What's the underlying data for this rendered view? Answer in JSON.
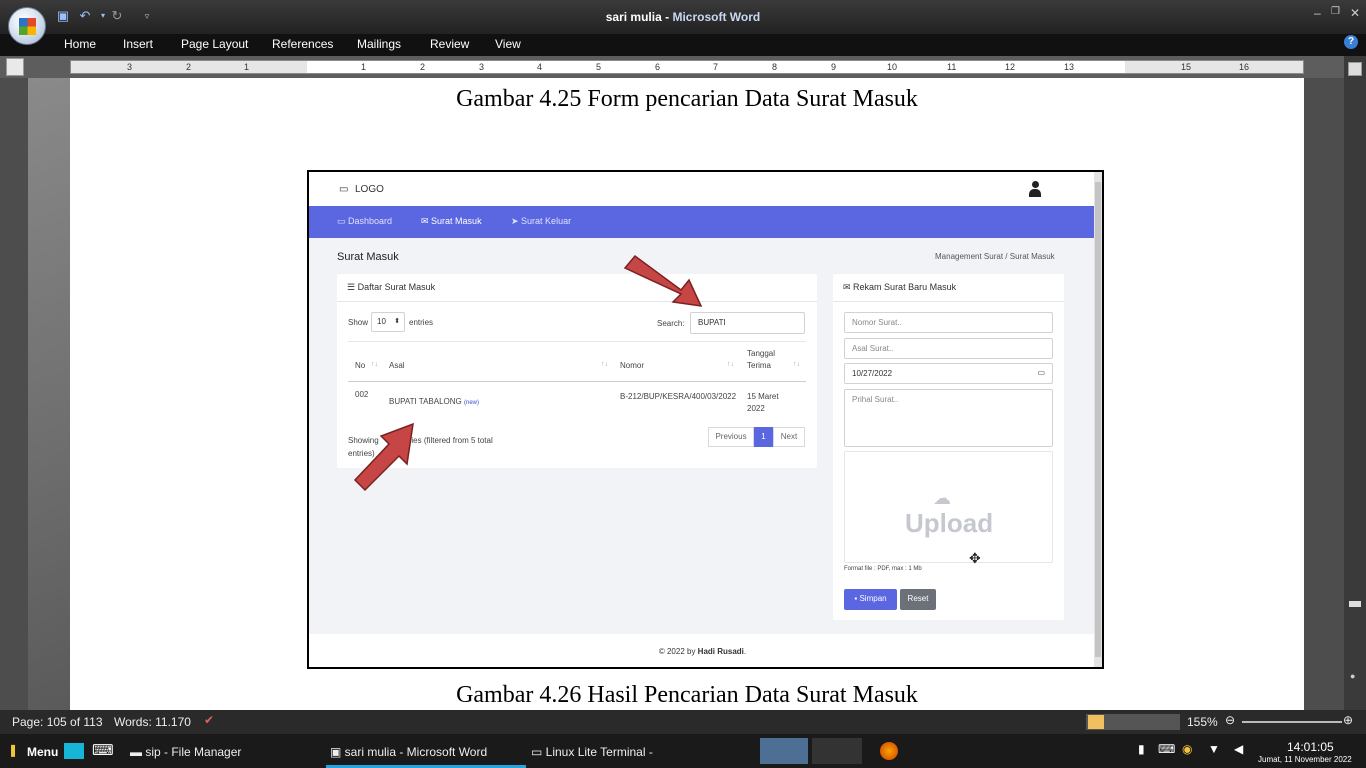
{
  "window": {
    "doc_title": "sari mulia",
    "separator": " - ",
    "app_name": "Microsoft Word"
  },
  "ribbon_tabs": [
    "Home",
    "Insert",
    "Page Layout",
    "References",
    "Mailings",
    "Review",
    "View"
  ],
  "ruler_numbers": [
    "3",
    "2",
    "1",
    "1",
    "2",
    "3",
    "4",
    "5",
    "6",
    "7",
    "8",
    "9",
    "10",
    "11",
    "12",
    "13",
    "15",
    "16"
  ],
  "captions": {
    "top": "Gambar 4.25 Form pencarian Data Surat Masuk",
    "bottom": "Gambar 4.26 Hasil Pencarian Data Surat Masuk"
  },
  "app": {
    "logo": "LOGO",
    "nav": [
      "Dashboard",
      "Surat Masuk",
      "Surat Keluar"
    ],
    "page_title": "Surat Masuk",
    "breadcrumb": [
      "Management Surat",
      "/",
      "Surat Masuk"
    ],
    "list_card": {
      "title": "Daftar Surat Masuk",
      "show_label": "Show",
      "show_value": "10",
      "entries_label": "entries",
      "search_label": "Search:",
      "search_value": "BUPATI",
      "columns": [
        "No",
        "Asal",
        "Nomor",
        "Tanggal Terima"
      ],
      "row": {
        "no": "002",
        "asal": "BUPATI TABALONG",
        "badge": "(new)",
        "nomor": "B-212/BUP/KESRA/400/03/2022",
        "tanggal": "15 Maret 2022"
      },
      "info_a": "Showing",
      "info_b": "1 entries (filtered from 5 total",
      "info_c": "entries)",
      "pagination": [
        "Previous",
        "1",
        "Next"
      ]
    },
    "form_card": {
      "title": "Rekam Surat Baru Masuk",
      "nomor_placeholder": "Nomor Surat..",
      "asal_placeholder": "Asal Surat..",
      "date_value": "10/27/2022",
      "perihal_placeholder": "Prihal Surat..",
      "upload_label": "Upload",
      "format_note": "Format file : PDF, max : 1 Mb",
      "save_label": "Simpan",
      "reset_label": "Reset"
    },
    "footer_prefix": "© 2022 by ",
    "footer_name": "Hadi Rusadi",
    "footer_suffix": "."
  },
  "status": {
    "page": "Page: 105 of 113",
    "words": "Words: 11.170",
    "zoom": "155%"
  },
  "taskbar": {
    "menu": "Menu",
    "items": [
      "sip - File Manager",
      "sari mulia - Microsoft Word",
      "Linux Lite Terminal -"
    ],
    "time": "14:01:05",
    "date": "Jumat, 11 November 2022"
  }
}
